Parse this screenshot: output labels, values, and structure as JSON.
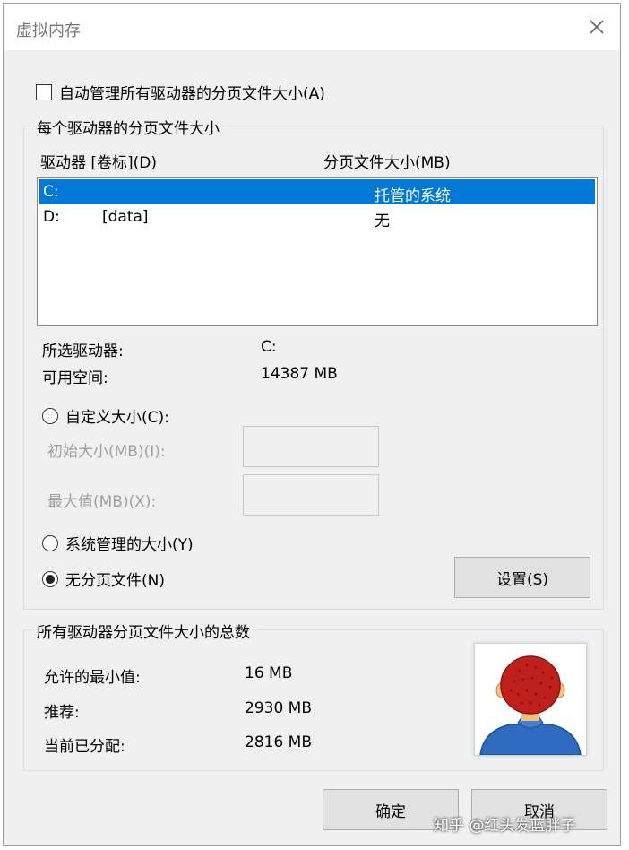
{
  "window": {
    "title": "虚拟内存"
  },
  "auto_manage": {
    "label": "自动管理所有驱动器的分页文件大小(A)",
    "checked": false
  },
  "per_drive": {
    "group_title": "每个驱动器的分页文件大小",
    "col_drive": "驱动器 [卷标](D)",
    "col_size": "分页文件大小(MB)",
    "drives": [
      {
        "name": "C:",
        "volume": "",
        "size": "托管的系统",
        "selected": true
      },
      {
        "name": "D:",
        "volume": "[data]",
        "size": "无",
        "selected": false
      }
    ],
    "selected_drive_label": "所选驱动器:",
    "selected_drive_value": "C:",
    "free_space_label": "可用空间:",
    "free_space_value": "14387 MB",
    "custom_size_label": "自定义大小(C):",
    "initial_size_label": "初始大小(MB)(I):",
    "max_size_label": "最大值(MB)(X):",
    "system_managed_label": "系统管理的大小(Y)",
    "no_paging_label": "无分页文件(N)",
    "set_button": "设置(S)"
  },
  "totals": {
    "group_title": "所有驱动器分页文件大小的总数",
    "min_label": "允许的最小值:",
    "min_value": "16 MB",
    "recommended_label": "推荐:",
    "recommended_value": "2930 MB",
    "allocated_label": "当前已分配:",
    "allocated_value": "2816 MB"
  },
  "buttons": {
    "ok": "确定",
    "cancel": "取消"
  },
  "watermark": "知乎 @红头发蓝胖子",
  "colors": {
    "selection": "#0078d7",
    "hair": "#c0201c",
    "shirt": "#2f6cc0"
  },
  "icons": {
    "close": "close-icon",
    "avatar": "avatar-image"
  }
}
